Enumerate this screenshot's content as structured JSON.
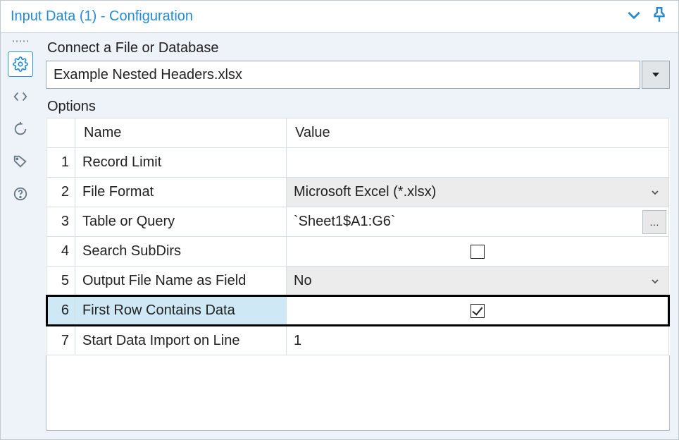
{
  "title": "Input Data (1) - Configuration",
  "connect_label": "Connect a File or Database",
  "file_path": "Example Nested Headers.xlsx",
  "options_label": "Options",
  "columns": {
    "name": "Name",
    "value": "Value"
  },
  "rows": [
    {
      "n": "1",
      "name": "Record Limit",
      "type": "text",
      "value": ""
    },
    {
      "n": "2",
      "name": "File Format",
      "type": "dropdown",
      "value": "Microsoft Excel (*.xlsx)"
    },
    {
      "n": "3",
      "name": "Table or Query",
      "type": "browse",
      "value": "`Sheet1$A1:G6`"
    },
    {
      "n": "4",
      "name": "Search SubDirs",
      "type": "check",
      "value": false
    },
    {
      "n": "5",
      "name": "Output File Name as Field",
      "type": "dropdown",
      "value": "No"
    },
    {
      "n": "6",
      "name": "First Row Contains Data",
      "type": "check",
      "value": true,
      "selected": true
    },
    {
      "n": "7",
      "name": "Start Data Import on Line",
      "type": "text",
      "value": "1"
    }
  ]
}
